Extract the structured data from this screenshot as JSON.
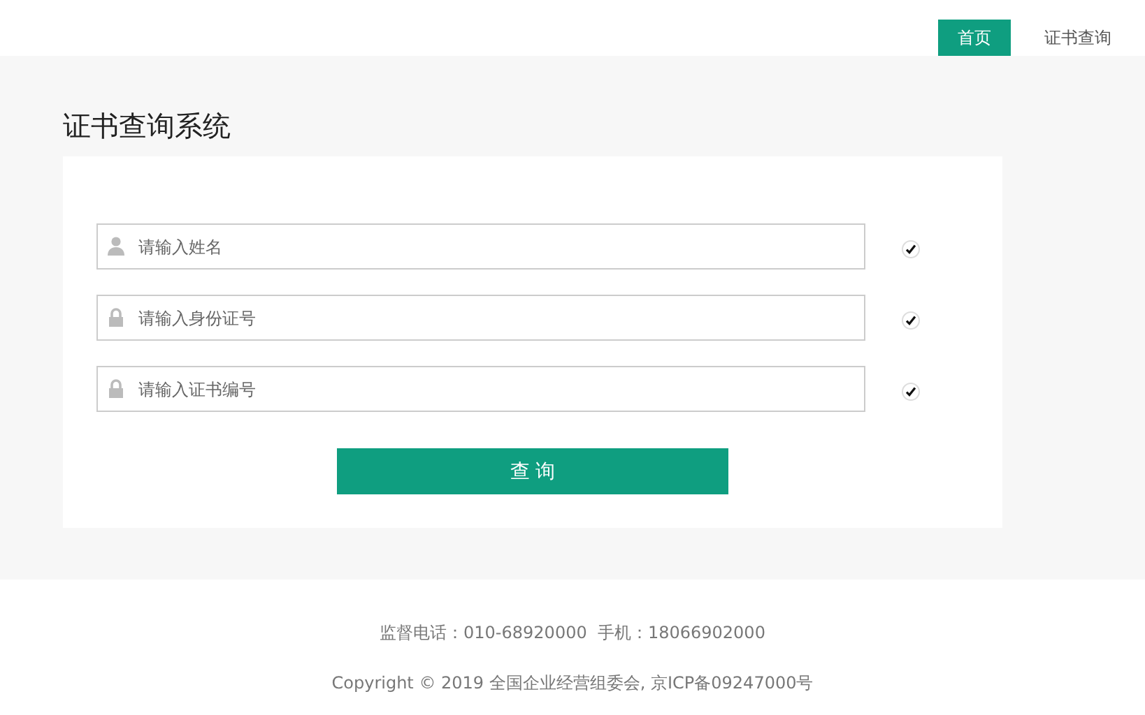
{
  "nav": [
    {
      "label": "首页",
      "selected": true
    },
    {
      "label": "证书查询",
      "selected": false
    }
  ],
  "page_title": "证书查询系统",
  "fields": [
    {
      "kind": "user",
      "placeholder": "请输入姓名"
    },
    {
      "kind": "lock",
      "placeholder": "请输入身份证号"
    },
    {
      "kind": "lock",
      "placeholder": "请输入证书编号"
    }
  ],
  "submit": "查 询",
  "footer": [
    "监督电话：010-68920000  手机：18066902000",
    "Copyright © 2019 全国企业经营组委会, 京ICP备09247000号"
  ]
}
